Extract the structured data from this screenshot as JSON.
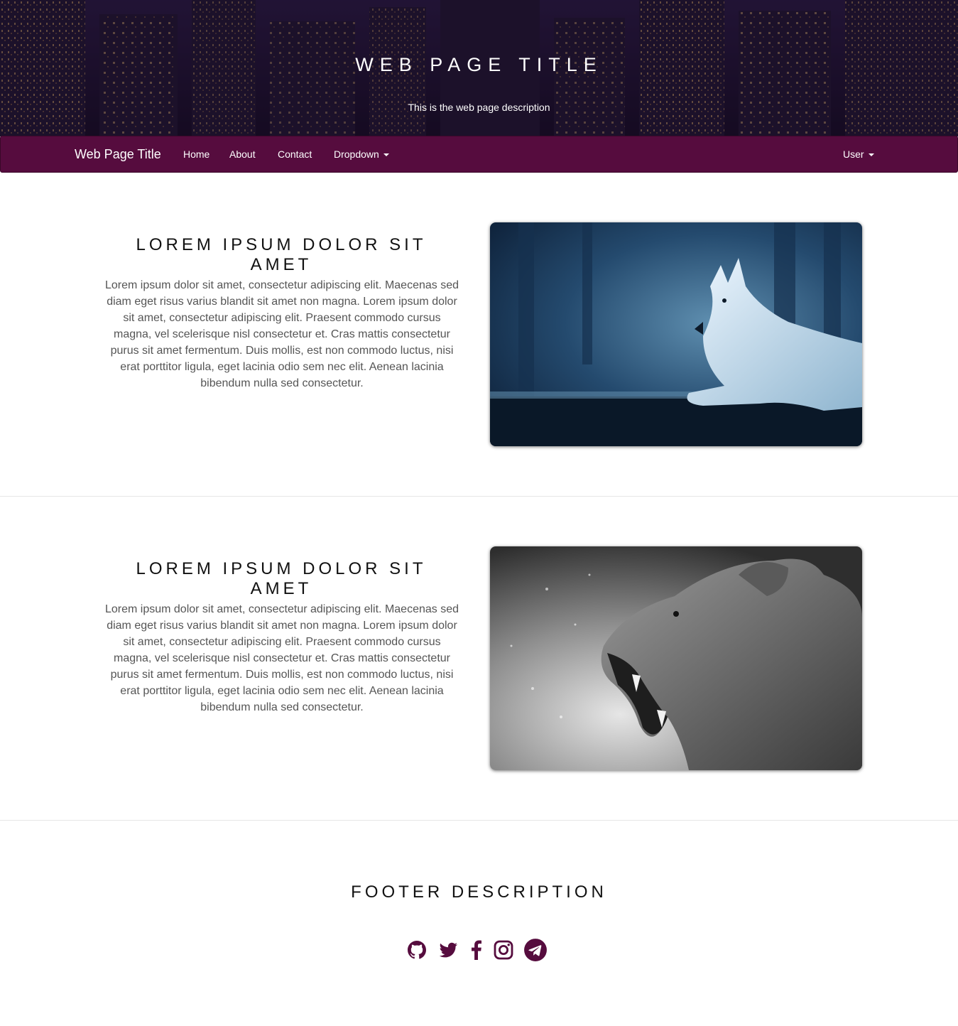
{
  "header": {
    "title": "WEB PAGE TITLE",
    "description": "This is the web page description"
  },
  "navbar": {
    "brand": "Web Page Title",
    "items": [
      {
        "label": "Home"
      },
      {
        "label": "About"
      },
      {
        "label": "Contact"
      },
      {
        "label": "Dropdown"
      }
    ],
    "user_menu": "User"
  },
  "sections": [
    {
      "heading": "LOREM IPSUM DOLOR SIT AMET",
      "text": "Lorem ipsum dolor sit amet, consectetur adipiscing elit. Maecenas sed diam eget risus varius blandit sit amet non magna. Lorem ipsum dolor sit amet, consectetur adipiscing elit. Praesent commodo cursus magna, vel scelerisque nisl consectetur et. Cras mattis consectetur purus sit amet fermentum. Duis mollis, est non commodo luctus, nisi erat porttitor ligula, eget lacinia odio sem nec elit. Aenean lacinia bibendum nulla sed consectetur.",
      "image": "wolf-image"
    },
    {
      "heading": "LOREM IPSUM DOLOR SIT AMET",
      "text": "Lorem ipsum dolor sit amet, consectetur adipiscing elit. Maecenas sed diam eget risus varius blandit sit amet non magna. Lorem ipsum dolor sit amet, consectetur adipiscing elit. Praesent commodo cursus magna, vel scelerisque nisl consectetur et. Cras mattis consectetur purus sit amet fermentum. Duis mollis, est non commodo luctus, nisi erat porttitor ligula, eget lacinia odio sem nec elit. Aenean lacinia bibendum nulla sed consectetur.",
      "image": "lioness-image"
    }
  ],
  "footer": {
    "title": "FOOTER DESCRIPTION",
    "social_icons": [
      "github-icon",
      "twitter-icon",
      "facebook-icon",
      "instagram-icon",
      "telegram-icon"
    ]
  },
  "colors": {
    "brand": "#560c3e",
    "nav_text": "#ffffff",
    "heading": "#111111",
    "body_text": "#555555"
  }
}
